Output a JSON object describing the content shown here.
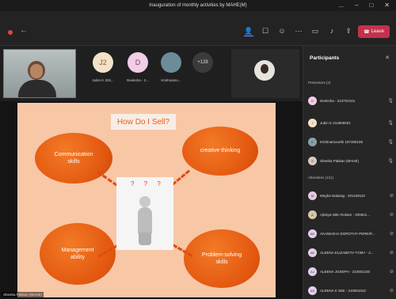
{
  "window": {
    "title": "Inauguration of monthly activities by MAHE(M)",
    "controls": [
      "...",
      "–",
      "□",
      "✕"
    ]
  },
  "toolbar": {
    "icons": [
      "people-icon",
      "chat-icon",
      "reactions-icon",
      "more-icon",
      "camera-icon",
      "mic-icon",
      "share-icon"
    ],
    "leave_label": "Leave"
  },
  "video_strip": {
    "tiles": [
      {
        "initials": "J2",
        "name": "Jubin K 202...",
        "color": "#f3e2c8"
      },
      {
        "initials": "D",
        "name": "Deeksha - 2...",
        "color": "#f1cde6"
      },
      {
        "initials": "",
        "name": "Krishnamo...",
        "color": "#6c8c9a"
      }
    ],
    "overflow_count": "+128"
  },
  "slide": {
    "title": "How Do I Sell?",
    "bubbles": {
      "top_left": "Communication skills",
      "top_right": "creative thinking",
      "bottom_left": "Management ability",
      "bottom_right": "Problem-solving skills"
    },
    "center_marks": "? ? ?",
    "presenter_label": "Sheeba Pakkan (MAHE)"
  },
  "participants": {
    "title": "Participants",
    "presenters_heading": "Presenters (4)",
    "presenters": [
      {
        "name": "Deeksha - 213702101",
        "initials": "D",
        "color": "#f1cde6"
      },
      {
        "name": "Jubin K 212806001",
        "initials": "J",
        "color": "#f3e2c8"
      },
      {
        "name": "Krishnamoorthi 197308106",
        "initials": "K",
        "color": "#8aa0a8"
      },
      {
        "name": "Sheeba Pakkan (MAHE)",
        "initials": "S",
        "color": "#d7c9c0"
      }
    ],
    "attendees_heading": "Attendees (121)",
    "attendees": [
      {
        "name": "Megha Natarag - 201108110",
        "initials": "M",
        "color": "#e6c6e2"
      },
      {
        "name": "Ajinkya Nitin Rokam - 200601...",
        "initials": "A",
        "color": "#d9c5a8"
      },
      {
        "name": "AKANKSHA DOROTHY PEREIR...",
        "initials": "AD",
        "color": "#e2d0ea"
      },
      {
        "name": "ALEENA ELIZABETH TOMY - 2...",
        "initials": "AE",
        "color": "#e2d0ea"
      },
      {
        "name": "ALEENA JOSEPH - 210601100",
        "initials": "AJ",
        "color": "#e2d0ea"
      },
      {
        "name": "ALEENA K SIBI - 210601042",
        "initials": "AS",
        "color": "#e2d0ea"
      }
    ]
  },
  "colors": {
    "accent": "#8f8cf5",
    "leave": "#c4314b",
    "slide_bg": "#f8c7a6",
    "bubble": "#e2570f"
  }
}
